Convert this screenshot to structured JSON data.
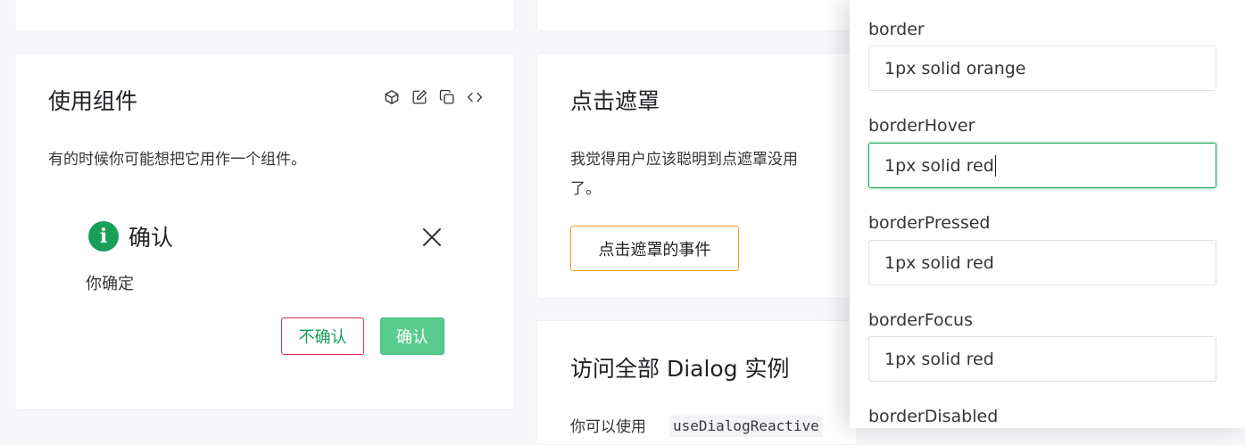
{
  "card_component": {
    "title": "使用组件",
    "description": "有的时候你可能想把它用作一个组件。",
    "toolbar_icons": [
      "cube-icon",
      "edit-icon",
      "copy-icon",
      "code-icon"
    ],
    "dialog": {
      "icon": "info-icon",
      "icon_glyph": "i",
      "title": "确认",
      "content": "你确定",
      "negative_label": "不确认",
      "positive_label": "确认"
    }
  },
  "card_mask": {
    "title": "点击遮罩",
    "description_line1": "我觉得用户应该聪明到点遮罩没用",
    "description_line2": "了。",
    "button_label": "点击遮罩的事件"
  },
  "card_instances": {
    "title": "访问全部 Dialog 实例",
    "description_prefix": "你可以使用",
    "code": "useDialogReactive"
  },
  "drawer": {
    "fields": [
      {
        "label": "border",
        "value": "1px solid orange",
        "focused": false
      },
      {
        "label": "borderHover",
        "value": "1px solid red",
        "focused": true
      },
      {
        "label": "borderPressed",
        "value": "1px solid red",
        "focused": false
      },
      {
        "label": "borderFocus",
        "value": "1px solid red",
        "focused": false
      },
      {
        "label": "borderDisabled",
        "value": "",
        "focused": false
      }
    ]
  },
  "colors": {
    "primary": "#18a058",
    "error": "#d03050",
    "warning": "#f0a020"
  }
}
